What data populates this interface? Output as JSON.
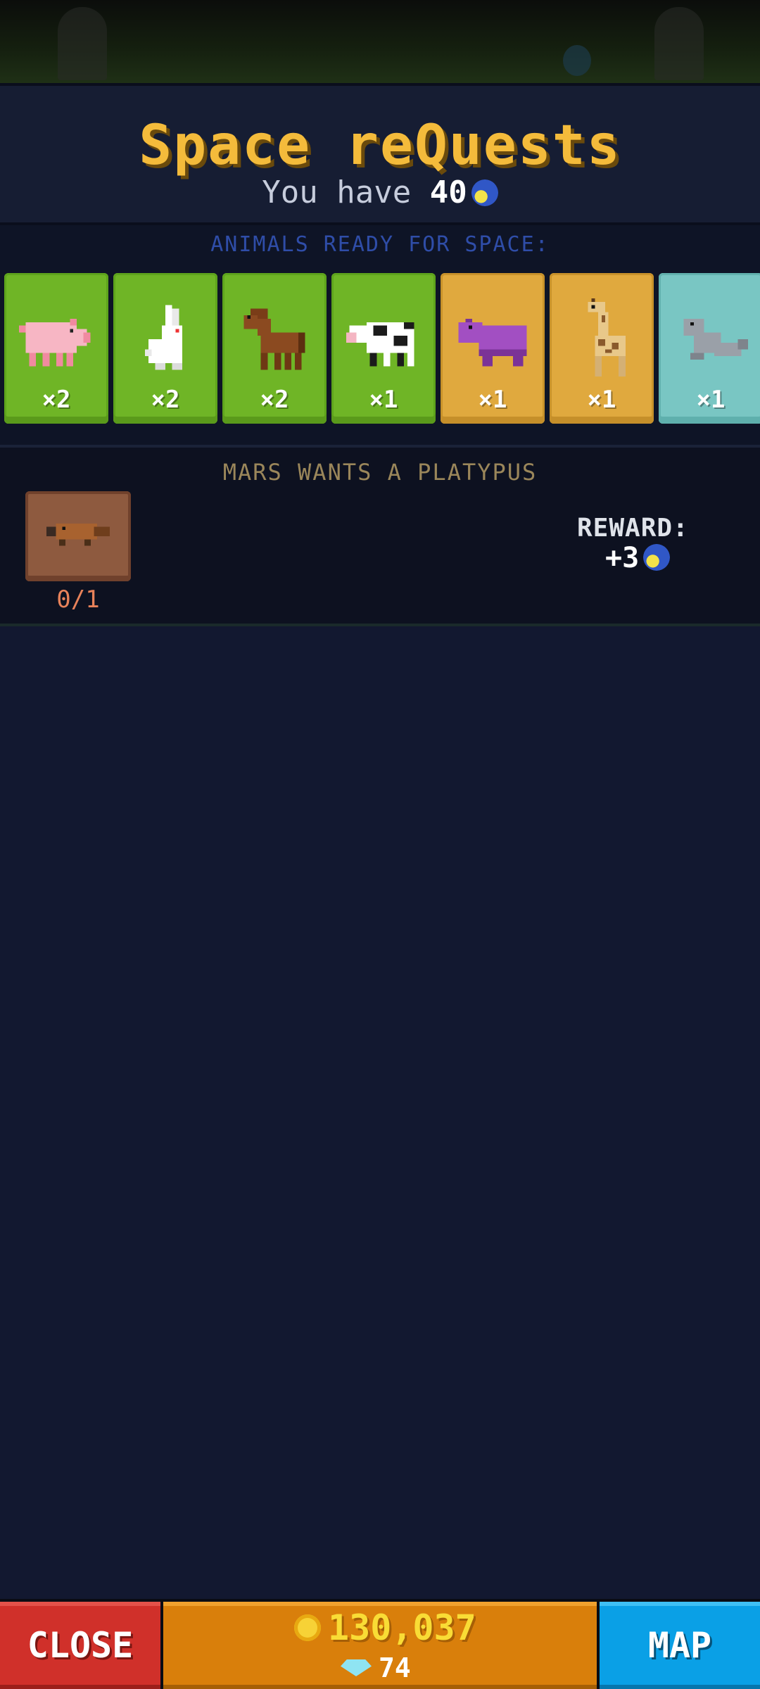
{
  "header": {
    "title": "Space reQuests",
    "balance_prefix": "You have",
    "balance_value": "40",
    "balance_icon": "moon-token-icon"
  },
  "ready": {
    "label": "ANIMALS READY FOR SPACE:",
    "cards": [
      {
        "animal": "pig",
        "count": "×2",
        "color": "#6fb526"
      },
      {
        "animal": "rabbit",
        "count": "×2",
        "color": "#6fb526"
      },
      {
        "animal": "horse",
        "count": "×2",
        "color": "#6fb526"
      },
      {
        "animal": "cow",
        "count": "×1",
        "color": "#6fb526"
      },
      {
        "animal": "hippo",
        "count": "×1",
        "color": "#e0a93e"
      },
      {
        "animal": "giraffe",
        "count": "×1",
        "color": "#e0a93e"
      },
      {
        "animal": "seal",
        "count": "×1",
        "color": "#79c6c3"
      }
    ]
  },
  "quest": {
    "title": "MARS WANTS A PLATYPUS",
    "animal": "platypus",
    "progress": "0/1",
    "reward_label": "REWARD:",
    "reward_value": "+3"
  },
  "footer": {
    "close_label": "CLOSE",
    "coins": "130,037",
    "gems": "74",
    "map_label": "MAP"
  }
}
